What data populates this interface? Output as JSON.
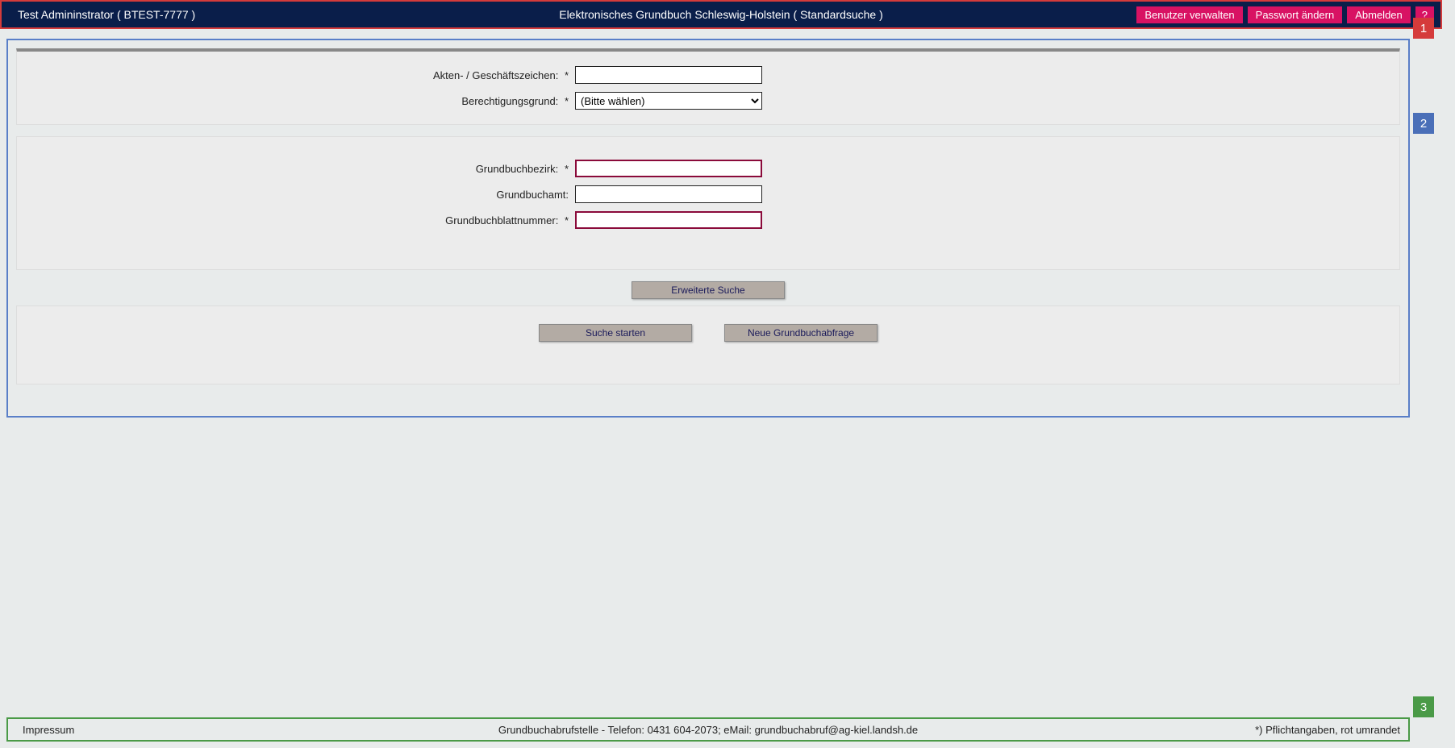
{
  "header": {
    "user": "Test Admininstrator  ( BTEST-7777 )",
    "title": "Elektronisches Grundbuch Schleswig-Holstein  ( Standardsuche )",
    "actions": {
      "manage_users": "Benutzer verwalten",
      "change_password": "Passwort ändern",
      "logout": "Abmelden",
      "help": "?"
    }
  },
  "form": {
    "aktenzeichen_label": "Akten- / Geschäftszeichen:",
    "berechtigung_label": "Berechtigungsgrund:",
    "berechtigung_selected": "(Bitte wählen)",
    "grundbuchbezirk_label": "Grundbuchbezirk:",
    "grundbuchamt_label": "Grundbuchamt:",
    "grundbuchblatt_label": "Grundbuchblattnummer:",
    "required_star": "*"
  },
  "buttons": {
    "extended_search": "Erweiterte Suche",
    "start_search": "Suche starten",
    "new_query": "Neue Grundbuchabfrage"
  },
  "footer": {
    "left": "Impressum",
    "center": "Grundbuchabrufstelle - Telefon: 0431 604-2073; eMail: grundbuchabruf@ag-kiel.landsh.de",
    "right": "*) Pflichtangaben, rot umrandet"
  },
  "markers": {
    "m1": "1",
    "m2": "2",
    "m3": "3"
  }
}
